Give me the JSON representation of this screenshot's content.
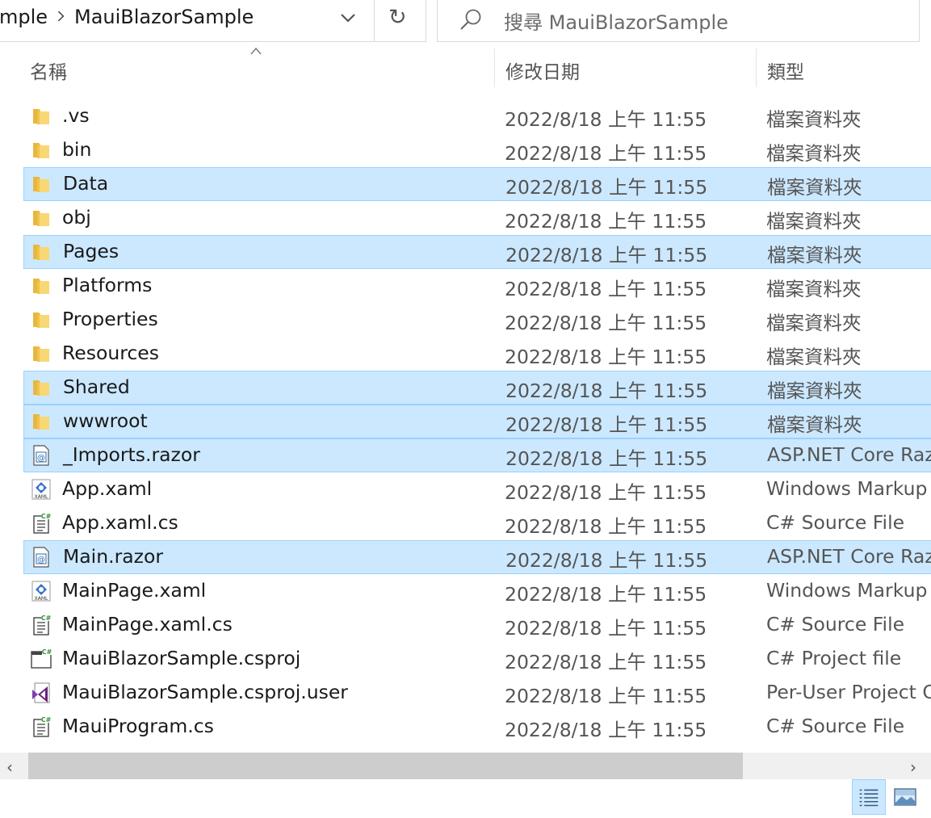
{
  "address": {
    "crumbs": [
      "mple",
      "MauiBlazorSample"
    ]
  },
  "search": {
    "placeholder": "搜尋 MauiBlazorSample"
  },
  "columns": {
    "name": "名稱",
    "date": "修改日期",
    "type": "類型"
  },
  "files": [
    {
      "name": ".vs",
      "date": "2022/8/18 上午 11:55",
      "type": "檔案資料夾",
      "icon": "folder-icon",
      "selected": false
    },
    {
      "name": "bin",
      "date": "2022/8/18 上午 11:55",
      "type": "檔案資料夾",
      "icon": "folder-icon",
      "selected": false
    },
    {
      "name": "Data",
      "date": "2022/8/18 上午 11:55",
      "type": "檔案資料夾",
      "icon": "folder-icon",
      "selected": true
    },
    {
      "name": "obj",
      "date": "2022/8/18 上午 11:55",
      "type": "檔案資料夾",
      "icon": "folder-icon",
      "selected": false
    },
    {
      "name": "Pages",
      "date": "2022/8/18 上午 11:55",
      "type": "檔案資料夾",
      "icon": "folder-icon",
      "selected": true
    },
    {
      "name": "Platforms",
      "date": "2022/8/18 上午 11:55",
      "type": "檔案資料夾",
      "icon": "folder-icon",
      "selected": false
    },
    {
      "name": "Properties",
      "date": "2022/8/18 上午 11:55",
      "type": "檔案資料夾",
      "icon": "folder-icon",
      "selected": false
    },
    {
      "name": "Resources",
      "date": "2022/8/18 上午 11:55",
      "type": "檔案資料夾",
      "icon": "folder-icon",
      "selected": false
    },
    {
      "name": "Shared",
      "date": "2022/8/18 上午 11:55",
      "type": "檔案資料夾",
      "icon": "folder-icon",
      "selected": true
    },
    {
      "name": "wwwroot",
      "date": "2022/8/18 上午 11:55",
      "type": "檔案資料夾",
      "icon": "folder-icon",
      "selected": true
    },
    {
      "name": "_Imports.razor",
      "date": "2022/8/18 上午 11:55",
      "type": "ASP.NET Core Razor",
      "icon": "razor-file-icon",
      "selected": true
    },
    {
      "name": "App.xaml",
      "date": "2022/8/18 上午 11:55",
      "type": "Windows Markup",
      "icon": "xaml-file-icon",
      "selected": false
    },
    {
      "name": "App.xaml.cs",
      "date": "2022/8/18 上午 11:55",
      "type": "C# Source File",
      "icon": "csharp-file-icon",
      "selected": false
    },
    {
      "name": "Main.razor",
      "date": "2022/8/18 上午 11:55",
      "type": "ASP.NET Core Razor",
      "icon": "razor-file-icon",
      "selected": true
    },
    {
      "name": "MainPage.xaml",
      "date": "2022/8/18 上午 11:55",
      "type": "Windows Markup",
      "icon": "xaml-file-icon",
      "selected": false
    },
    {
      "name": "MainPage.xaml.cs",
      "date": "2022/8/18 上午 11:55",
      "type": "C# Source File",
      "icon": "csharp-file-icon",
      "selected": false
    },
    {
      "name": "MauiBlazorSample.csproj",
      "date": "2022/8/18 上午 11:55",
      "type": "C# Project file",
      "icon": "csproj-file-icon",
      "selected": false
    },
    {
      "name": "MauiBlazorSample.csproj.user",
      "date": "2022/8/18 上午 11:55",
      "type": "Per-User Project C",
      "icon": "visual-studio-file-icon",
      "selected": false
    },
    {
      "name": "MauiProgram.cs",
      "date": "2022/8/18 上午 11:55",
      "type": "C# Source File",
      "icon": "csharp-file-icon",
      "selected": false
    }
  ],
  "colors": {
    "selection": "#cce8ff",
    "selection_border": "#99d1ff",
    "folder": "#f8d775"
  },
  "view_buttons": [
    {
      "icon": "details-view-icon",
      "active": true
    },
    {
      "icon": "large-icons-view-icon",
      "active": false
    }
  ]
}
